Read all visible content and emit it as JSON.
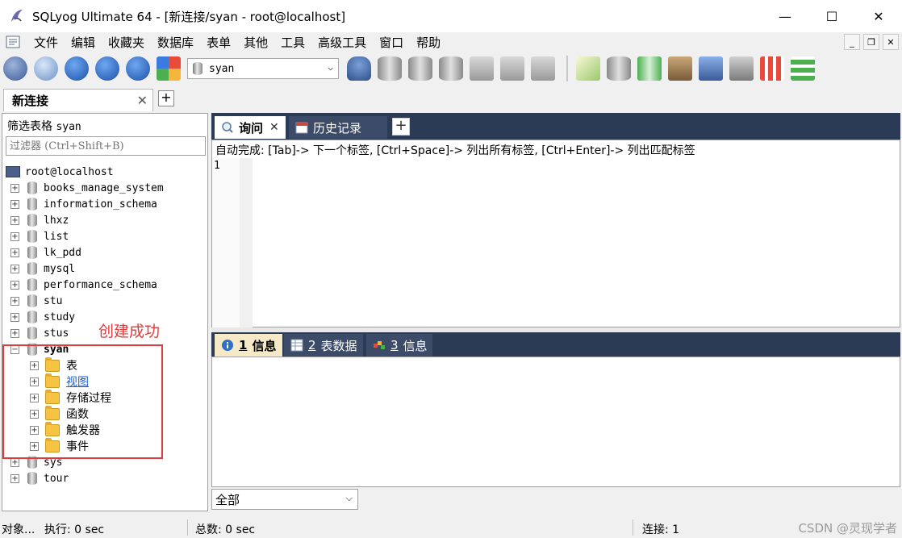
{
  "window": {
    "title": "SQLyog Ultimate 64 - [新连接/syan - root@localhost]",
    "minimize": "—",
    "maximize": "☐",
    "close": "✕"
  },
  "menu": {
    "items": [
      "文件",
      "编辑",
      "收藏夹",
      "数据库",
      "表单",
      "其他",
      "工具",
      "高级工具",
      "窗口",
      "帮助"
    ],
    "mdi_minimize": "_",
    "mdi_restore": "❐",
    "mdi_close": "✕"
  },
  "toolbar": {
    "selected_database": "syan",
    "dropdown_arrow": "⌵"
  },
  "connection_tabs": {
    "active_label": "新连接",
    "close": "✕",
    "add": "+"
  },
  "sidebar": {
    "filter_label_prefix": "筛选表格",
    "filter_label_db": "syan",
    "filter_placeholder": "过滤器 (Ctrl+Shift+B)",
    "root": "root@localhost",
    "databases": [
      "books_manage_system",
      "information_schema",
      "lhxz",
      "list",
      "lk_pdd",
      "mysql",
      "performance_schema",
      "stu",
      "study",
      "stus"
    ],
    "expanded_db": "syan",
    "folders": [
      "表",
      "视图",
      "存储过程",
      "函数",
      "触发器",
      "事件"
    ],
    "after_dbs": [
      "sys",
      "tour"
    ],
    "expand_plus": "+",
    "expand_minus": "−"
  },
  "annotation": "创建成功",
  "query_tabs": {
    "active": "询问",
    "active_close": "✕",
    "history": "历史记录",
    "add": "+"
  },
  "editor": {
    "hint": "自动完成: [Tab]-> 下一个标签, [Ctrl+Space]-> 列出所有标签, [Ctrl+Enter]-> 列出匹配标签",
    "line_number": "1"
  },
  "result_tabs": [
    {
      "num": "1",
      "label": "信息"
    },
    {
      "num": "2",
      "label": "表数据"
    },
    {
      "num": "3",
      "label": "信息"
    }
  ],
  "result_filter": {
    "value": "全部",
    "arrow": "⌵"
  },
  "statusbar": {
    "objects": "对象...",
    "exec": "执行: 0 sec",
    "total": "总数: 0 sec",
    "connections": "连接: 1",
    "watermark": "CSDN @灵现学者"
  }
}
